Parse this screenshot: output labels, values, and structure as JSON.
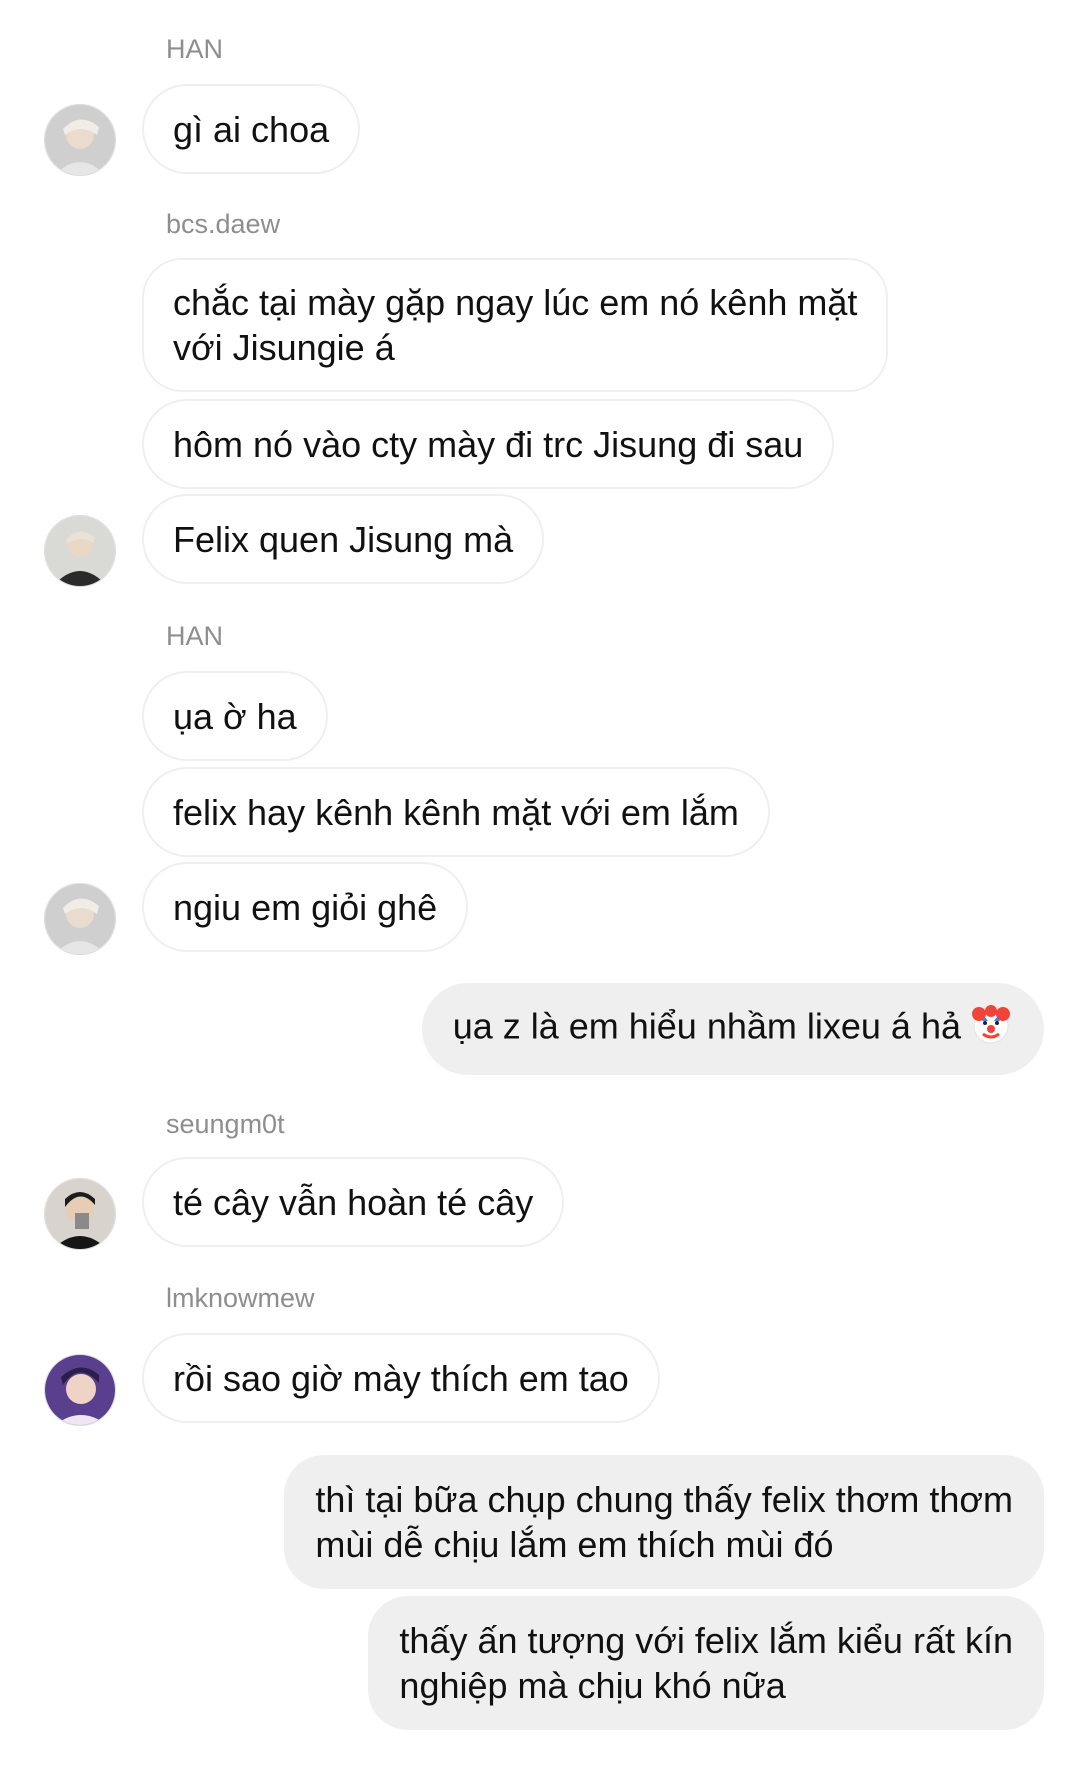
{
  "messages": {
    "sender_han_1": "HAN",
    "m1": "gì ai choa",
    "sender_bcs": "bcs.daew",
    "m2_line1": "chắc tại mày gặp ngay lúc em nó kênh mặt",
    "m2_line2": "với Jisungie á",
    "m3": "hôm nó vào cty mày đi trc Jisung đi sau",
    "m4": "Felix quen Jisung mà",
    "sender_han_2": "HAN",
    "m5": "ụa ờ ha",
    "m6": "felix hay kênh kênh mặt với em lắm",
    "m7": "ngiu em giỏi ghê",
    "m8": "ụa z là em hiểu nhầm lixeu á hả",
    "sender_seung": "seungm0t",
    "m9": "té cây vẫn hoàn té cây",
    "sender_lmk": "lmknowmew",
    "m10": "rồi sao giờ mày thích em tao",
    "m11_line1": "thì tại bữa chụp chung thấy felix thơm thơm",
    "m11_line2": "mùi dễ chịu lắm em thích mùi đó",
    "m12_line1": "thấy ấn tượng với felix lắm kiểu rất kín",
    "m12_line2": "nghiệp mà chịu khó nữa"
  },
  "icons": {
    "clown": "clown-face-icon"
  },
  "colors": {
    "incoming_bubble": "#ffffff",
    "incoming_border": "#efefef",
    "outgoing_bubble": "#efefef",
    "sender_name": "#8e8e8e",
    "text": "#111111"
  }
}
